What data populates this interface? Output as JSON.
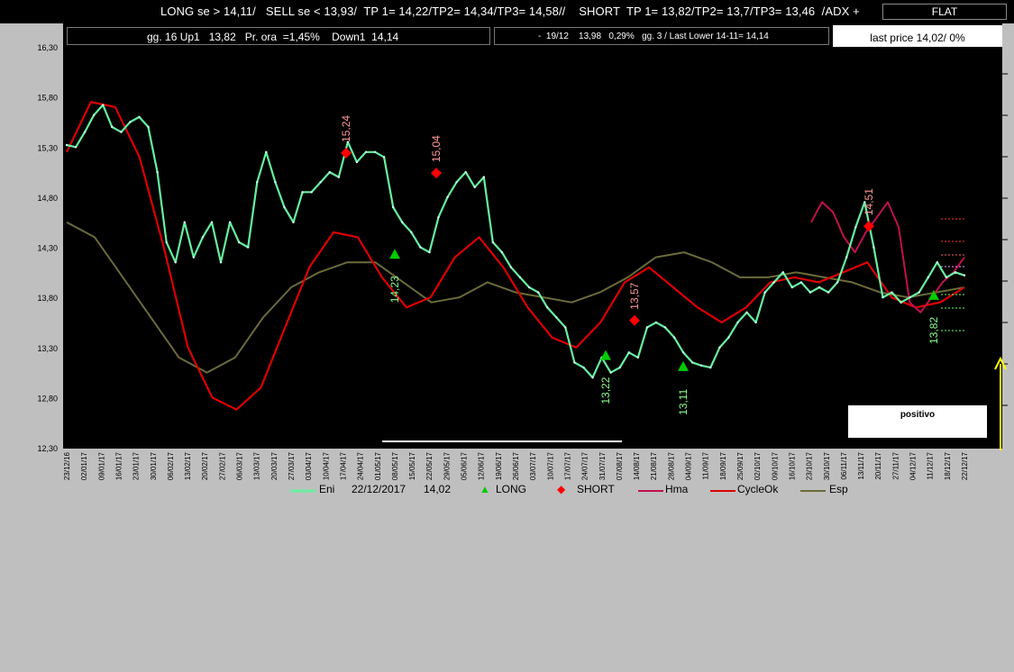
{
  "header": {
    "signal_line": "LONG se > 14,11/   SELL se < 13,93/  TP 1= 14,22/TP2= 14,34/TP3= 14,58//    SHORT  TP 1= 13,82/TP2= 13,7/TP3= 13,46  /ADX +",
    "status": "FLAT"
  },
  "info": {
    "left": "gg. 16 Up1   13,82   Pr. ora  =1,45%    Down1  14,14",
    "middle": "-  19/12    13,98   0,29%   gg. 3 / Last Lower 14-11= 14,14",
    "right": "last price 14,02/  0%"
  },
  "positivo": "positivo",
  "legend": {
    "eni": "Eni",
    "date": "22/12/2017",
    "price": "14,02",
    "long": "LONG",
    "short": "SHORT",
    "hma": "Hma",
    "cycle": "CycleOk",
    "esp": "Esp"
  },
  "colors": {
    "eni": "#66f0a0",
    "long": "#00cc00",
    "short": "#ff0000",
    "hma": "#c01050",
    "cycle": "#dd0000",
    "esp": "#6b6b3a"
  },
  "chart_data": {
    "type": "line",
    "ylim": [
      12.3,
      16.3
    ],
    "yticks": [
      "16,30",
      "15,80",
      "15,30",
      "14,80",
      "14,30",
      "13,80",
      "13,30",
      "12,80",
      "12,30"
    ],
    "xticks": [
      "23/12/16",
      "02/01/17",
      "09/01/17",
      "16/01/17",
      "23/01/17",
      "30/01/17",
      "06/02/17",
      "13/02/17",
      "20/02/17",
      "27/02/17",
      "06/03/17",
      "13/03/17",
      "20/03/17",
      "27/03/17",
      "03/04/17",
      "10/04/17",
      "17/04/17",
      "24/04/17",
      "01/05/17",
      "08/05/17",
      "15/05/17",
      "22/05/17",
      "29/05/17",
      "05/06/17",
      "12/06/17",
      "19/06/17",
      "26/06/17",
      "03/07/17",
      "10/07/17",
      "17/07/17",
      "24/07/17",
      "31/07/17",
      "07/08/17",
      "14/08/17",
      "21/08/17",
      "28/08/17",
      "04/09/17",
      "11/09/17",
      "18/09/17",
      "25/09/17",
      "02/10/17",
      "09/10/17",
      "16/10/17",
      "23/10/17",
      "30/10/17",
      "06/11/17",
      "13/11/17",
      "20/11/17",
      "27/11/17",
      "04/12/17",
      "11/12/17",
      "18/12/17",
      "22/12/17"
    ],
    "series": [
      {
        "name": "Eni",
        "values": [
          15.32,
          15.3,
          15.45,
          15.62,
          15.72,
          15.5,
          15.45,
          15.55,
          15.6,
          15.5,
          15.05,
          14.35,
          14.15,
          14.55,
          14.2,
          14.4,
          14.55,
          14.15,
          14.55,
          14.35,
          14.3,
          14.95,
          15.25,
          14.95,
          14.7,
          14.55,
          14.85,
          14.85,
          14.95,
          15.05,
          15.0,
          15.35,
          15.15,
          15.25,
          15.25,
          15.2,
          14.7,
          14.55,
          14.45,
          14.3,
          14.25,
          14.6,
          14.8,
          14.95,
          15.05,
          14.9,
          15.0,
          14.35,
          14.25,
          14.1,
          14.0,
          13.9,
          13.85,
          13.7,
          13.6,
          13.5,
          13.15,
          13.1,
          13.0,
          13.2,
          13.05,
          13.1,
          13.25,
          13.2,
          13.5,
          13.55,
          13.5,
          13.4,
          13.25,
          13.15,
          13.12,
          13.1,
          13.3,
          13.4,
          13.55,
          13.65,
          13.55,
          13.85,
          13.95,
          14.05,
          13.9,
          13.95,
          13.85,
          13.9,
          13.85,
          13.95,
          14.2,
          14.5,
          14.75,
          14.3,
          13.8,
          13.85,
          13.75,
          13.8,
          13.85,
          14.0,
          14.15,
          14.0,
          14.05,
          14.02
        ]
      },
      {
        "name": "Hma",
        "values": [
          14.55,
          14.75,
          14.65,
          14.4,
          14.25,
          14.45,
          14.6,
          14.75,
          14.5,
          13.75,
          13.65,
          13.8,
          13.95,
          14.05,
          14.2
        ]
      },
      {
        "name": "CycleOk",
        "values": [
          15.25,
          15.75,
          15.7,
          15.2,
          14.3,
          13.3,
          12.8,
          12.68,
          12.9,
          13.5,
          14.1,
          14.45,
          14.4,
          14.0,
          13.7,
          13.8,
          14.2,
          14.4,
          14.1,
          13.7,
          13.4,
          13.3,
          13.55,
          13.95,
          14.1,
          13.9,
          13.7,
          13.55,
          13.7,
          13.95,
          14.0,
          13.95,
          14.05,
          14.15,
          13.8,
          13.7,
          13.75,
          13.9
        ]
      },
      {
        "name": "Esp",
        "values": [
          14.55,
          14.4,
          14.0,
          13.6,
          13.2,
          13.05,
          13.2,
          13.6,
          13.9,
          14.05,
          14.15,
          14.15,
          13.95,
          13.75,
          13.8,
          13.95,
          13.85,
          13.8,
          13.75,
          13.85,
          14.0,
          14.2,
          14.25,
          14.15,
          14.0,
          14.0,
          14.05,
          14.0,
          13.95,
          13.85,
          13.8,
          13.85,
          13.9
        ]
      }
    ],
    "signals": {
      "short": [
        {
          "label": "15,24",
          "value": 15.24
        },
        {
          "label": "15,04",
          "value": 15.04
        },
        {
          "label": "13,57",
          "value": 13.57
        },
        {
          "label": "14,51",
          "value": 14.51
        }
      ],
      "long": [
        {
          "label": "14,23",
          "value": 14.23
        },
        {
          "label": "13,22",
          "value": 13.22
        },
        {
          "label": "13,11",
          "value": 13.11
        },
        {
          "label": "13,82",
          "value": 13.82
        }
      ]
    }
  }
}
